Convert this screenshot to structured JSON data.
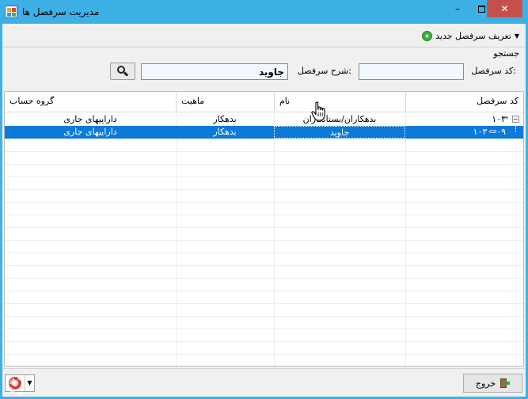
{
  "window": {
    "title": "مدیریت سرفصل ها",
    "minimize_symbol": "–",
    "close_symbol": "✕"
  },
  "toolbar": {
    "new_item_label": "تعریف سرفصل جدید",
    "new_item_icon": "plus-circle-icon",
    "dropdown_arrow": "▼"
  },
  "search": {
    "group_title": "جستجو",
    "code_label": "کد سرفصل:",
    "code_value": "",
    "description_label": "شرح سرفصل:",
    "description_value": "جاوید",
    "button_icon": "search-icon"
  },
  "grid": {
    "columns": {
      "code": "کد سرفصل",
      "name": "نام",
      "nature": "ماهیت",
      "account_group": "گروه حساب"
    },
    "rows": [
      {
        "code": "۱۰۳",
        "name": "بدهکاران/بستانکاران",
        "nature": "بدهکار",
        "account_group": "داراییهای جاری",
        "selected": false
      },
      {
        "code": "۱۰۳۰۰۰۹",
        "name": "جاوید",
        "nature": "بدهکار",
        "account_group": "داراییهای جاری",
        "selected": true
      }
    ]
  },
  "footer": {
    "exit_label": "خروج",
    "help_icon": "lifebuoy-icon",
    "dropdown_arrow": "▼"
  },
  "colors": {
    "titlebar": "#3db0e6",
    "selection": "#0c7ad8",
    "close_button": "#c7504d",
    "input_background": "#f3f7ff"
  }
}
